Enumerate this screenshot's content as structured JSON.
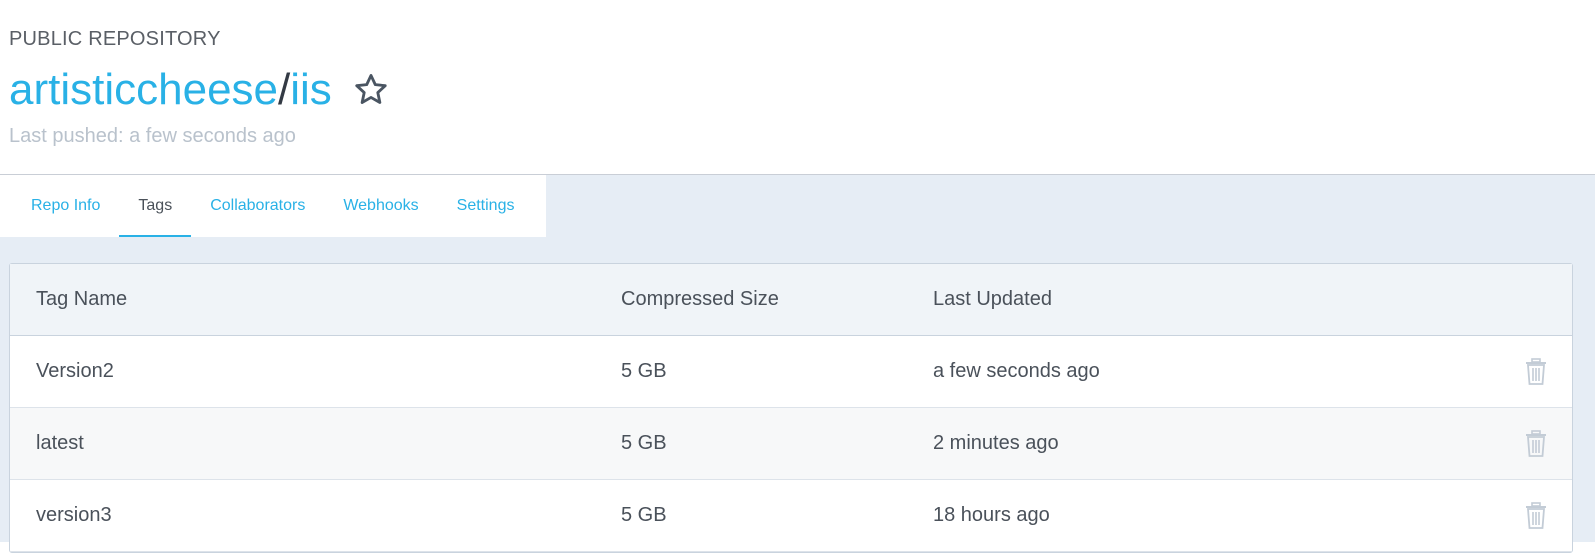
{
  "repo": {
    "visibility": "PUBLIC REPOSITORY",
    "owner": "artisticcheese",
    "separator": "/",
    "name": "iis",
    "last_pushed": "Last pushed: a few seconds ago"
  },
  "tabs": [
    {
      "label": "Repo Info"
    },
    {
      "label": "Tags"
    },
    {
      "label": "Collaborators"
    },
    {
      "label": "Webhooks"
    },
    {
      "label": "Settings"
    }
  ],
  "active_tab": "Tags",
  "table": {
    "headers": {
      "tag_name": "Tag Name",
      "size": "Compressed Size",
      "updated": "Last Updated"
    },
    "rows": [
      {
        "tag": "Version2",
        "size": "5 GB",
        "updated": "a few seconds ago"
      },
      {
        "tag": "latest",
        "size": "5 GB",
        "updated": "2 minutes ago"
      },
      {
        "tag": "version3",
        "size": "5 GB",
        "updated": "18 hours ago"
      }
    ]
  },
  "icons": {
    "star": "star-outline-icon",
    "delete": "trash-icon"
  },
  "colors": {
    "accent": "#29b1e6",
    "muted_text": "#b9c2cc",
    "page_bg": "#e6edf5"
  }
}
